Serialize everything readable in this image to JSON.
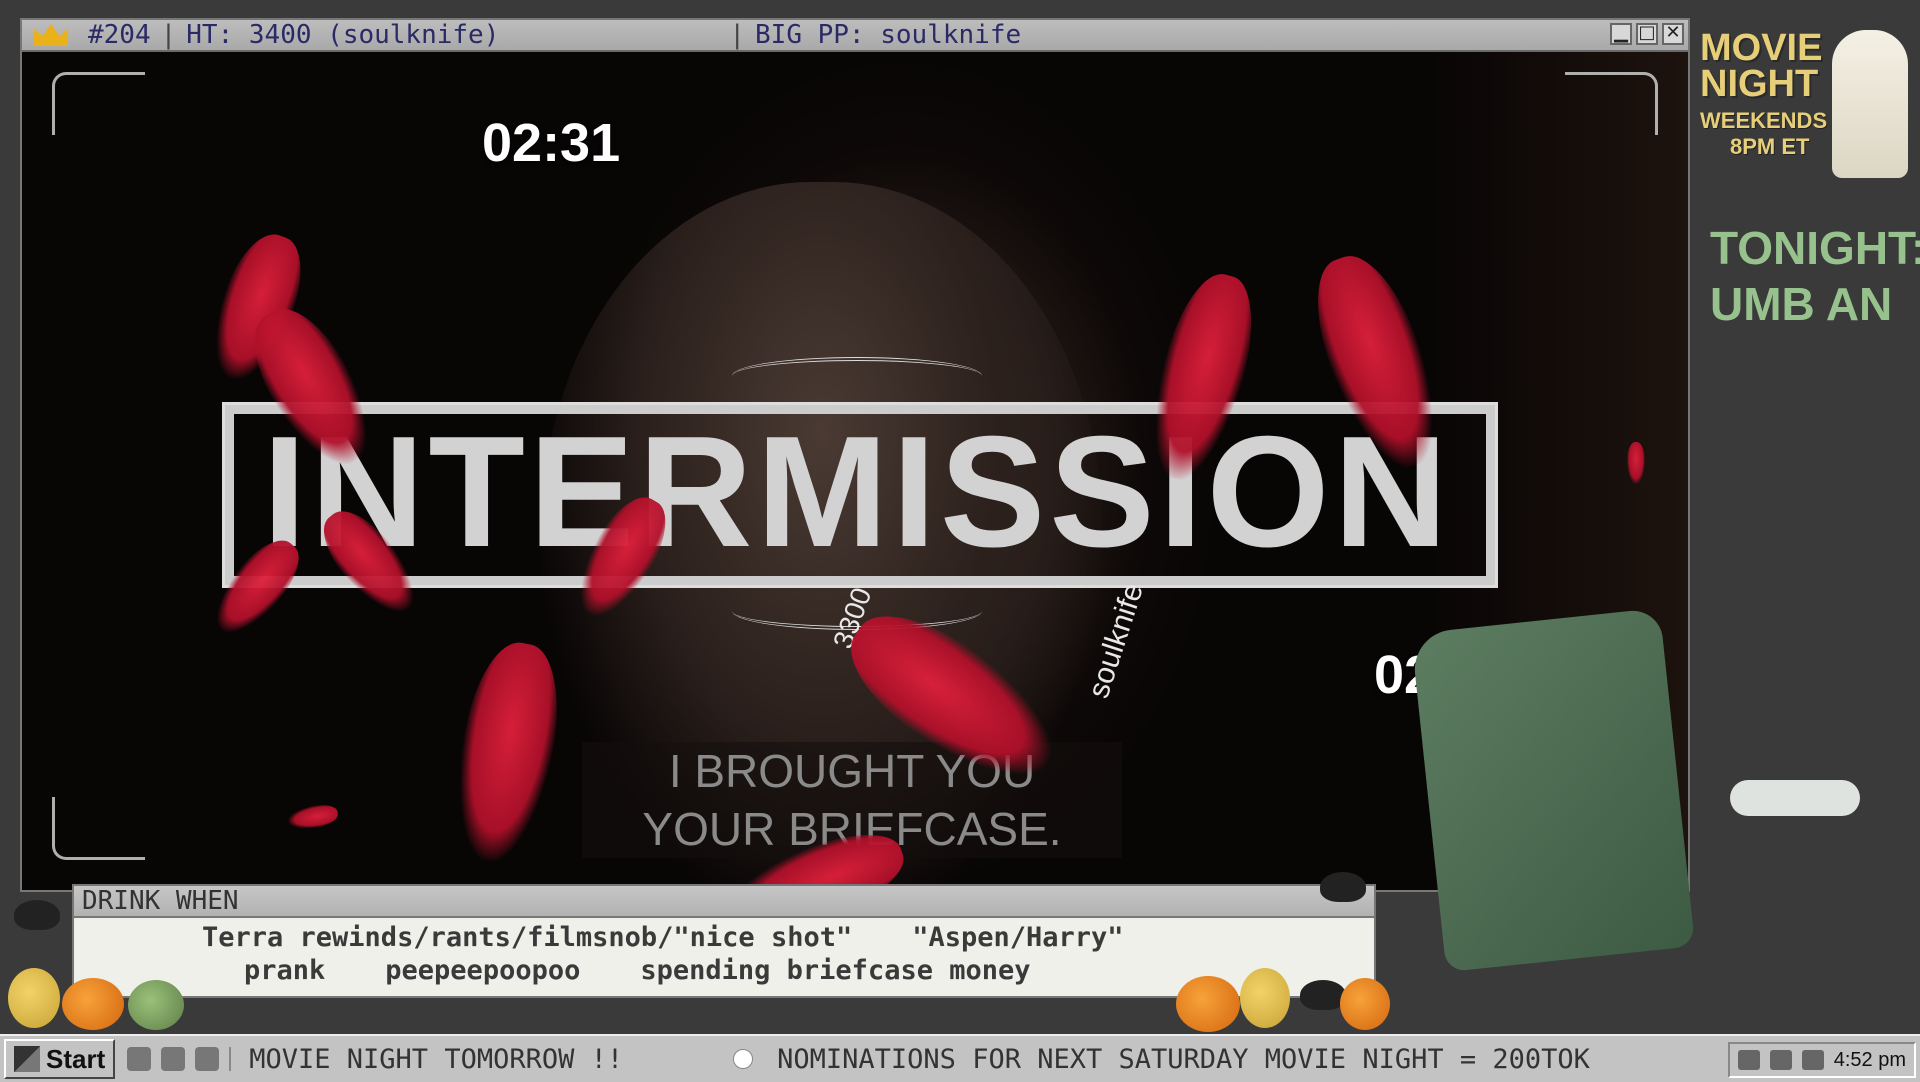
{
  "title_bar": {
    "rank": "#204",
    "hype_train": "HT: 3400 (soulknife)",
    "separator": "|",
    "big_pp": "BIG PP: soulknife",
    "controls": [
      "minimize",
      "maximize",
      "close"
    ]
  },
  "stream": {
    "timer_top": "02:31",
    "timer_bottom": "02:31",
    "banner": "INTERMISSION",
    "subtitle_line1": "I BROUGHT YOU",
    "subtitle_line2": "YOUR BRIEFCASE.",
    "overlay_name": "soulknife",
    "overlay_amount": "3300"
  },
  "drink_panel": {
    "title": "DRINK WHEN",
    "row1": [
      "Terra rewinds/rants/filmsnob/\"nice shot\"",
      "\"Aspen/Harry\""
    ],
    "row2": [
      "prank",
      "peepeepoopoo",
      "spending briefcase money"
    ]
  },
  "sidebar": {
    "movie_night_line1": "MOVIE",
    "movie_night_line2": "NIGHT",
    "schedule_line1": "WEEKENDS",
    "schedule_line2": "8PM ET",
    "tonight_label": "TONIGHT:",
    "tonight_movie": "UMB AN"
  },
  "taskbar": {
    "start_label": "Start",
    "ticker_1": "MOVIE NIGHT TOMORROW !!",
    "ticker_2": "NOMINATIONS FOR NEXT SATURDAY MOVIE NIGHT = 200TOK",
    "clock": "4:52 pm"
  },
  "colors": {
    "title_text": "#2a2a66",
    "movie_night_gold": "#e7cf7a",
    "tonight_green": "#97c28d",
    "lobster_red": "#c8102e"
  }
}
